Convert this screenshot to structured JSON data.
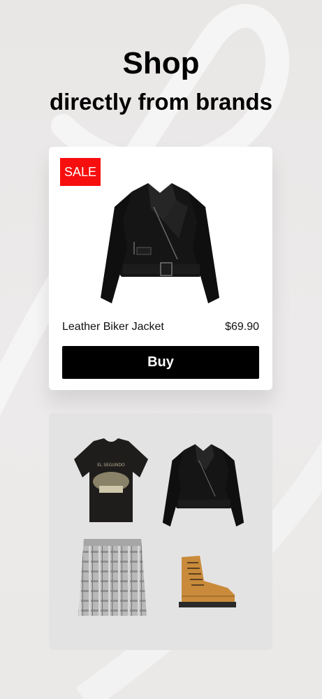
{
  "headline": {
    "title": "Shop",
    "subtitle": "directly from brands"
  },
  "product_card": {
    "badge": "SALE",
    "product_name": "Leather Biker Jacket",
    "price": "$69.90",
    "buy_label": "Buy",
    "image": "black-leather-biker-jacket"
  },
  "outfit_card": {
    "items": [
      {
        "image": "black-graphic-tshirt",
        "print_text": "EL SEGUNDO"
      },
      {
        "image": "black-leather-biker-jacket"
      },
      {
        "image": "grey-plaid-mini-skirt"
      },
      {
        "image": "tan-lace-up-combat-boot"
      }
    ]
  },
  "colors": {
    "background": "#ebe9e8",
    "sale_badge": "#f70e0e",
    "buy_button": "#000000"
  }
}
